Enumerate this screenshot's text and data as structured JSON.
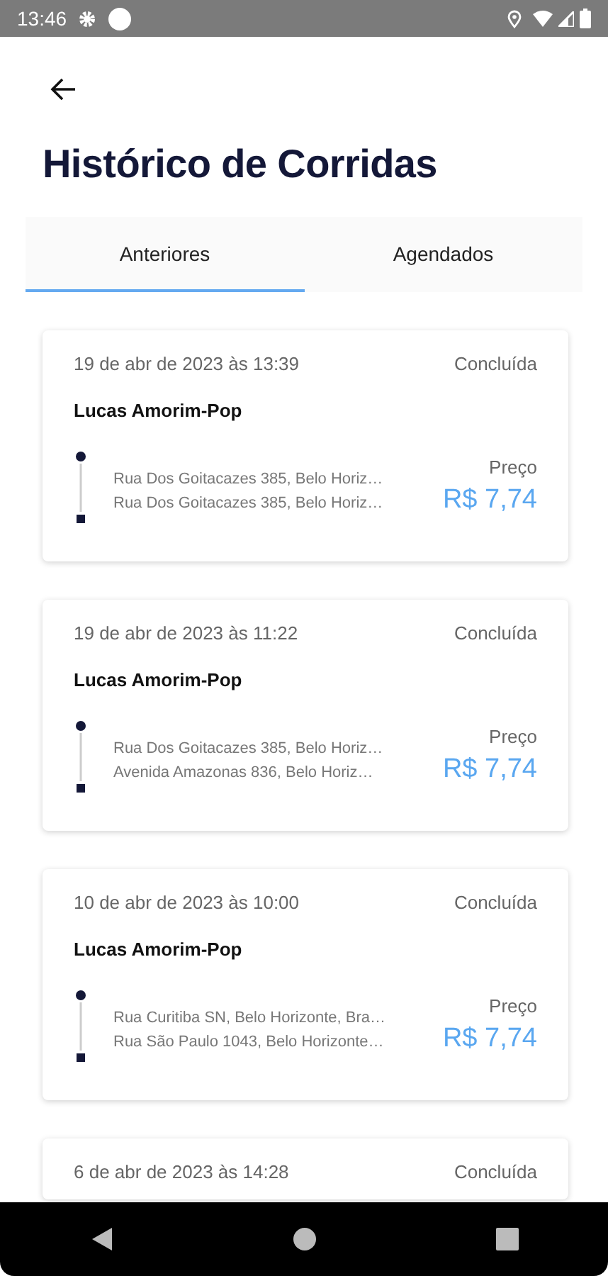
{
  "status_bar": {
    "time": "13:46"
  },
  "title": "Histórico de Corridas",
  "tabs": [
    {
      "label": "Anteriores",
      "selected": true
    },
    {
      "label": "Agendados",
      "selected": false
    }
  ],
  "rides": [
    {
      "date": "19 de abr de 2023 às 13:39",
      "status": "Concluída",
      "driver": "Lucas Amorim-Pop",
      "origin": "Rua Dos Goitacazes 385, Belo Horiz…",
      "destination": "Rua Dos Goitacazes 385, Belo Horiz…",
      "price_label": "Preço",
      "price": "R$ 7,74"
    },
    {
      "date": "19 de abr de 2023 às 11:22",
      "status": "Concluída",
      "driver": "Lucas Amorim-Pop",
      "origin": "Rua Dos Goitacazes 385, Belo Horiz…",
      "destination": "Avenida Amazonas 836, Belo Horiz…",
      "price_label": "Preço",
      "price": "R$ 7,74"
    },
    {
      "date": "10 de abr de 2023 às 10:00",
      "status": "Concluída",
      "driver": "Lucas Amorim-Pop",
      "origin": "Rua Curitiba SN, Belo Horizonte, Bra…",
      "destination": "Rua São Paulo 1043, Belo Horizonte…",
      "price_label": "Preço",
      "price": "R$ 7,74"
    },
    {
      "date": "6 de abr de 2023 às 14:28",
      "status": "Concluída"
    }
  ]
}
